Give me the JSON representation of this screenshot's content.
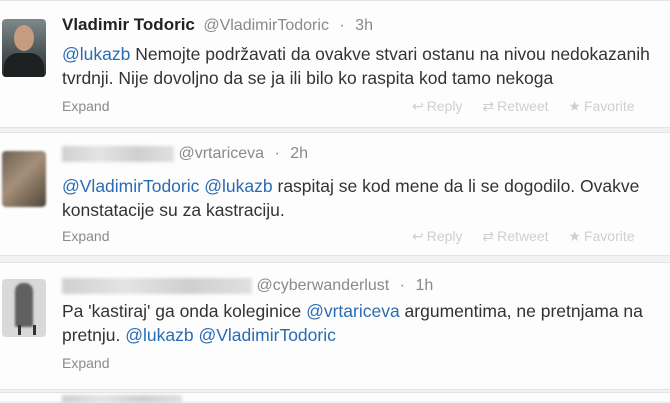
{
  "tweets": [
    {
      "fullname": "Vladimir Todoric",
      "username": "@VladimirTodoric",
      "time": "3h",
      "line1": [
        {
          "t": "@lukazb",
          "m": true
        },
        {
          "t": " Nemojte podržavati da ovakve stvari ostanu na nivou nedokazanih",
          "m": false
        }
      ],
      "line2": [
        {
          "t": "tvrdnji. Nije dovoljno da se ja ili bilo ko raspita kod tamo nekoga",
          "m": false
        }
      ],
      "expand": "Expand",
      "reply": "Reply",
      "retweet": "Retweet",
      "favorite": "Favorite"
    },
    {
      "username": "@vrtariceva",
      "time": "2h",
      "line1": [
        {
          "t": "@VladimirTodoric",
          "m": true
        },
        {
          "t": " ",
          "m": false
        },
        {
          "t": "@lukazb",
          "m": true
        },
        {
          "t": " raspitaj se kod mene da li se dogodilo. Ovakve",
          "m": false
        }
      ],
      "line2": [
        {
          "t": "konstatacije su za kastraciju.",
          "m": false
        }
      ],
      "expand": "Expand",
      "reply": "Reply",
      "retweet": "Retweet",
      "favorite": "Favorite"
    },
    {
      "username": "@cyberwanderlust",
      "time": "1h",
      "line1": [
        {
          "t": "Pa 'kastiraj' ga onda koleginice ",
          "m": false
        },
        {
          "t": "@vrtariceva",
          "m": true
        },
        {
          "t": " argumentima, ne pretnjama na",
          "m": false
        }
      ],
      "line2": [
        {
          "t": "pretnju.  ",
          "m": false
        },
        {
          "t": "@lukazb",
          "m": true
        },
        {
          "t": " ",
          "m": false
        },
        {
          "t": "@VladimirTodoric",
          "m": true
        }
      ],
      "expand": "Expand"
    }
  ],
  "colors": {
    "mention": "#2a6cb3",
    "meta": "#8a8a8a",
    "action": "#cfcfcf"
  },
  "icons": {
    "reply": "reply-icon",
    "retweet": "retweet-icon",
    "favorite": "star-icon"
  }
}
